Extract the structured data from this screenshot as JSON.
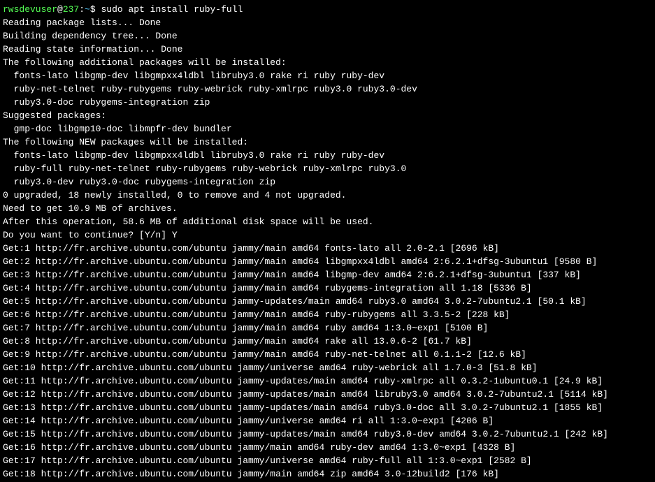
{
  "prompt": {
    "user": "rwsdevuser",
    "at": "@",
    "host": "237",
    "colon": ":",
    "path": "~",
    "dollar": "$ ",
    "command": "sudo apt install ruby-full"
  },
  "lines": {
    "l1": "Reading package lists... Done",
    "l2": "Building dependency tree... Done",
    "l3": "Reading state information... Done",
    "l4": "The following additional packages will be installed:",
    "l5": "  fonts-lato libgmp-dev libgmpxx4ldbl libruby3.0 rake ri ruby ruby-dev",
    "l6": "  ruby-net-telnet ruby-rubygems ruby-webrick ruby-xmlrpc ruby3.0 ruby3.0-dev",
    "l7": "  ruby3.0-doc rubygems-integration zip",
    "l8": "Suggested packages:",
    "l9": "  gmp-doc libgmp10-doc libmpfr-dev bundler",
    "l10": "The following NEW packages will be installed:",
    "l11": "  fonts-lato libgmp-dev libgmpxx4ldbl libruby3.0 rake ri ruby ruby-dev",
    "l12": "  ruby-full ruby-net-telnet ruby-rubygems ruby-webrick ruby-xmlrpc ruby3.0",
    "l13": "  ruby3.0-dev ruby3.0-doc rubygems-integration zip",
    "l14": "0 upgraded, 18 newly installed, 0 to remove and 4 not upgraded.",
    "l15": "Need to get 10.9 MB of archives.",
    "l16": "After this operation, 58.6 MB of additional disk space will be used.",
    "l17": "Do you want to continue? [Y/n] Y",
    "l18": "Get:1 http://fr.archive.ubuntu.com/ubuntu jammy/main amd64 fonts-lato all 2.0-2.1 [2696 kB]",
    "l19": "Get:2 http://fr.archive.ubuntu.com/ubuntu jammy/main amd64 libgmpxx4ldbl amd64 2:6.2.1+dfsg-3ubuntu1 [9580 B]",
    "l20": "Get:3 http://fr.archive.ubuntu.com/ubuntu jammy/main amd64 libgmp-dev amd64 2:6.2.1+dfsg-3ubuntu1 [337 kB]",
    "l21": "Get:4 http://fr.archive.ubuntu.com/ubuntu jammy/main amd64 rubygems-integration all 1.18 [5336 B]",
    "l22": "Get:5 http://fr.archive.ubuntu.com/ubuntu jammy-updates/main amd64 ruby3.0 amd64 3.0.2-7ubuntu2.1 [50.1 kB]",
    "l23": "Get:6 http://fr.archive.ubuntu.com/ubuntu jammy/main amd64 ruby-rubygems all 3.3.5-2 [228 kB]",
    "l24": "Get:7 http://fr.archive.ubuntu.com/ubuntu jammy/main amd64 ruby amd64 1:3.0~exp1 [5100 B]",
    "l25": "Get:8 http://fr.archive.ubuntu.com/ubuntu jammy/main amd64 rake all 13.0.6-2 [61.7 kB]",
    "l26": "Get:9 http://fr.archive.ubuntu.com/ubuntu jammy/main amd64 ruby-net-telnet all 0.1.1-2 [12.6 kB]",
    "l27": "Get:10 http://fr.archive.ubuntu.com/ubuntu jammy/universe amd64 ruby-webrick all 1.7.0-3 [51.8 kB]",
    "l28": "Get:11 http://fr.archive.ubuntu.com/ubuntu jammy-updates/main amd64 ruby-xmlrpc all 0.3.2-1ubuntu0.1 [24.9 kB]",
    "l29": "Get:12 http://fr.archive.ubuntu.com/ubuntu jammy-updates/main amd64 libruby3.0 amd64 3.0.2-7ubuntu2.1 [5114 kB]",
    "l30": "Get:13 http://fr.archive.ubuntu.com/ubuntu jammy-updates/main amd64 ruby3.0-doc all 3.0.2-7ubuntu2.1 [1855 kB]",
    "l31": "Get:14 http://fr.archive.ubuntu.com/ubuntu jammy/universe amd64 ri all 1:3.0~exp1 [4206 B]",
    "l32": "Get:15 http://fr.archive.ubuntu.com/ubuntu jammy-updates/main amd64 ruby3.0-dev amd64 3.0.2-7ubuntu2.1 [242 kB]",
    "l33": "Get:16 http://fr.archive.ubuntu.com/ubuntu jammy/main amd64 ruby-dev amd64 1:3.0~exp1 [4328 B]",
    "l34": "Get:17 http://fr.archive.ubuntu.com/ubuntu jammy/universe amd64 ruby-full all 1:3.0~exp1 [2582 B]",
    "l35": "Get:18 http://fr.archive.ubuntu.com/ubuntu jammy/main amd64 zip amd64 3.0-12build2 [176 kB]"
  }
}
